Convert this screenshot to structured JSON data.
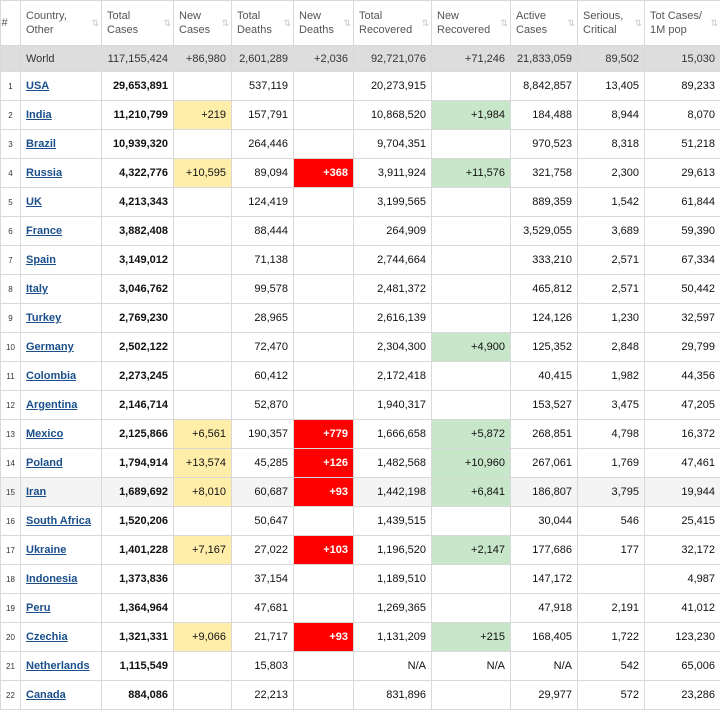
{
  "headers": {
    "num": "#",
    "country": "Country, Other",
    "total_cases": "Total Cases",
    "new_cases": "New Cases",
    "total_deaths": "Total Deaths",
    "new_deaths": "New Deaths",
    "total_recovered": "Total Recovered",
    "new_recovered": "New Recovered",
    "active_cases": "Active Cases",
    "serious_critical": "Serious, Critical",
    "tot_cases_1m": "Tot Cases/ 1M pop"
  },
  "sort_icon": "sort-arrows-icon",
  "colors": {
    "new_cases_highlight": "#ffeeaa",
    "new_deaths_highlight": "#ff0000",
    "new_recovered_highlight": "#c8e6c9",
    "link": "#1a4f8b"
  },
  "world": {
    "country": "World",
    "total_cases": "117,155,424",
    "new_cases": "+86,980",
    "total_deaths": "2,601,289",
    "new_deaths": "+2,036",
    "total_recovered": "92,721,076",
    "new_recovered": "+71,246",
    "active_cases": "21,833,059",
    "serious_critical": "89,502",
    "tot_cases_1m": "15,030"
  },
  "rows": [
    {
      "num": "1",
      "country": "USA",
      "total_cases": "29,653,891",
      "new_cases": "",
      "total_deaths": "537,119",
      "new_deaths": "",
      "total_recovered": "20,273,915",
      "new_recovered": "",
      "active_cases": "8,842,857",
      "serious_critical": "13,405",
      "tot_cases_1m": "89,233"
    },
    {
      "num": "2",
      "country": "India",
      "total_cases": "11,210,799",
      "new_cases": "+219",
      "total_deaths": "157,791",
      "new_deaths": "",
      "total_recovered": "10,868,520",
      "new_recovered": "+1,984",
      "active_cases": "184,488",
      "serious_critical": "8,944",
      "tot_cases_1m": "8,070"
    },
    {
      "num": "3",
      "country": "Brazil",
      "total_cases": "10,939,320",
      "new_cases": "",
      "total_deaths": "264,446",
      "new_deaths": "",
      "total_recovered": "9,704,351",
      "new_recovered": "",
      "active_cases": "970,523",
      "serious_critical": "8,318",
      "tot_cases_1m": "51,218"
    },
    {
      "num": "4",
      "country": "Russia",
      "total_cases": "4,322,776",
      "new_cases": "+10,595",
      "total_deaths": "89,094",
      "new_deaths": "+368",
      "total_recovered": "3,911,924",
      "new_recovered": "+11,576",
      "active_cases": "321,758",
      "serious_critical": "2,300",
      "tot_cases_1m": "29,613"
    },
    {
      "num": "5",
      "country": "UK",
      "total_cases": "4,213,343",
      "new_cases": "",
      "total_deaths": "124,419",
      "new_deaths": "",
      "total_recovered": "3,199,565",
      "new_recovered": "",
      "active_cases": "889,359",
      "serious_critical": "1,542",
      "tot_cases_1m": "61,844"
    },
    {
      "num": "6",
      "country": "France",
      "total_cases": "3,882,408",
      "new_cases": "",
      "total_deaths": "88,444",
      "new_deaths": "",
      "total_recovered": "264,909",
      "new_recovered": "",
      "active_cases": "3,529,055",
      "serious_critical": "3,689",
      "tot_cases_1m": "59,390"
    },
    {
      "num": "7",
      "country": "Spain",
      "total_cases": "3,149,012",
      "new_cases": "",
      "total_deaths": "71,138",
      "new_deaths": "",
      "total_recovered": "2,744,664",
      "new_recovered": "",
      "active_cases": "333,210",
      "serious_critical": "2,571",
      "tot_cases_1m": "67,334"
    },
    {
      "num": "8",
      "country": "Italy",
      "total_cases": "3,046,762",
      "new_cases": "",
      "total_deaths": "99,578",
      "new_deaths": "",
      "total_recovered": "2,481,372",
      "new_recovered": "",
      "active_cases": "465,812",
      "serious_critical": "2,571",
      "tot_cases_1m": "50,442"
    },
    {
      "num": "9",
      "country": "Turkey",
      "total_cases": "2,769,230",
      "new_cases": "",
      "total_deaths": "28,965",
      "new_deaths": "",
      "total_recovered": "2,616,139",
      "new_recovered": "",
      "active_cases": "124,126",
      "serious_critical": "1,230",
      "tot_cases_1m": "32,597"
    },
    {
      "num": "10",
      "country": "Germany",
      "total_cases": "2,502,122",
      "new_cases": "",
      "total_deaths": "72,470",
      "new_deaths": "",
      "total_recovered": "2,304,300",
      "new_recovered": "+4,900",
      "active_cases": "125,352",
      "serious_critical": "2,848",
      "tot_cases_1m": "29,799"
    },
    {
      "num": "11",
      "country": "Colombia",
      "total_cases": "2,273,245",
      "new_cases": "",
      "total_deaths": "60,412",
      "new_deaths": "",
      "total_recovered": "2,172,418",
      "new_recovered": "",
      "active_cases": "40,415",
      "serious_critical": "1,982",
      "tot_cases_1m": "44,356"
    },
    {
      "num": "12",
      "country": "Argentina",
      "total_cases": "2,146,714",
      "new_cases": "",
      "total_deaths": "52,870",
      "new_deaths": "",
      "total_recovered": "1,940,317",
      "new_recovered": "",
      "active_cases": "153,527",
      "serious_critical": "3,475",
      "tot_cases_1m": "47,205"
    },
    {
      "num": "13",
      "country": "Mexico",
      "total_cases": "2,125,866",
      "new_cases": "+6,561",
      "total_deaths": "190,357",
      "new_deaths": "+779",
      "total_recovered": "1,666,658",
      "new_recovered": "+5,872",
      "active_cases": "268,851",
      "serious_critical": "4,798",
      "tot_cases_1m": "16,372"
    },
    {
      "num": "14",
      "country": "Poland",
      "total_cases": "1,794,914",
      "new_cases": "+13,574",
      "total_deaths": "45,285",
      "new_deaths": "+126",
      "total_recovered": "1,482,568",
      "new_recovered": "+10,960",
      "active_cases": "267,061",
      "serious_critical": "1,769",
      "tot_cases_1m": "47,461"
    },
    {
      "num": "15",
      "country": "Iran",
      "total_cases": "1,689,692",
      "new_cases": "+8,010",
      "total_deaths": "60,687",
      "new_deaths": "+93",
      "total_recovered": "1,442,198",
      "new_recovered": "+6,841",
      "active_cases": "186,807",
      "serious_critical": "3,795",
      "tot_cases_1m": "19,944"
    },
    {
      "num": "16",
      "country": "South Africa",
      "total_cases": "1,520,206",
      "new_cases": "",
      "total_deaths": "50,647",
      "new_deaths": "",
      "total_recovered": "1,439,515",
      "new_recovered": "",
      "active_cases": "30,044",
      "serious_critical": "546",
      "tot_cases_1m": "25,415"
    },
    {
      "num": "17",
      "country": "Ukraine",
      "total_cases": "1,401,228",
      "new_cases": "+7,167",
      "total_deaths": "27,022",
      "new_deaths": "+103",
      "total_recovered": "1,196,520",
      "new_recovered": "+2,147",
      "active_cases": "177,686",
      "serious_critical": "177",
      "tot_cases_1m": "32,172"
    },
    {
      "num": "18",
      "country": "Indonesia",
      "total_cases": "1,373,836",
      "new_cases": "",
      "total_deaths": "37,154",
      "new_deaths": "",
      "total_recovered": "1,189,510",
      "new_recovered": "",
      "active_cases": "147,172",
      "serious_critical": "",
      "tot_cases_1m": "4,987"
    },
    {
      "num": "19",
      "country": "Peru",
      "total_cases": "1,364,964",
      "new_cases": "",
      "total_deaths": "47,681",
      "new_deaths": "",
      "total_recovered": "1,269,365",
      "new_recovered": "",
      "active_cases": "47,918",
      "serious_critical": "2,191",
      "tot_cases_1m": "41,012"
    },
    {
      "num": "20",
      "country": "Czechia",
      "total_cases": "1,321,331",
      "new_cases": "+9,066",
      "total_deaths": "21,717",
      "new_deaths": "+93",
      "total_recovered": "1,131,209",
      "new_recovered": "+215",
      "active_cases": "168,405",
      "serious_critical": "1,722",
      "tot_cases_1m": "123,230"
    },
    {
      "num": "21",
      "country": "Netherlands",
      "total_cases": "1,115,549",
      "new_cases": "",
      "total_deaths": "15,803",
      "new_deaths": "",
      "total_recovered": "N/A",
      "new_recovered": "N/A",
      "active_cases": "N/A",
      "serious_critical": "542",
      "tot_cases_1m": "65,006"
    },
    {
      "num": "22",
      "country": "Canada",
      "total_cases": "884,086",
      "new_cases": "",
      "total_deaths": "22,213",
      "new_deaths": "",
      "total_recovered": "831,896",
      "new_recovered": "",
      "active_cases": "29,977",
      "serious_critical": "572",
      "tot_cases_1m": "23,286"
    }
  ]
}
